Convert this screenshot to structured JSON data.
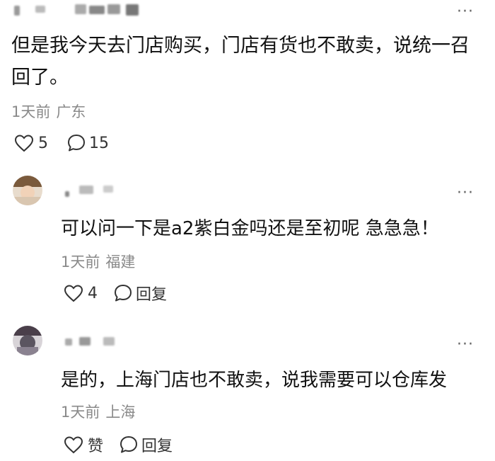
{
  "post": {
    "text": "但是我今天去门店购买，门店有货也不敢卖，说统一召回了。",
    "time": "1天前",
    "location": "广东",
    "likes": "5",
    "comments": "15"
  },
  "replies": [
    {
      "text": "可以问一下是a2紫白金吗还是至初呢 急急急！",
      "time": "1天前",
      "location": "福建",
      "likes": "4",
      "reply_label": "回复"
    },
    {
      "text": "是的，上海门店也不敢卖，说我需要可以仓库发",
      "time": "1天前",
      "location": "上海",
      "likes": "赞",
      "reply_label": "回复"
    }
  ],
  "icons": {
    "more": "more-icon",
    "like": "heart-icon",
    "comment": "comment-icon"
  }
}
